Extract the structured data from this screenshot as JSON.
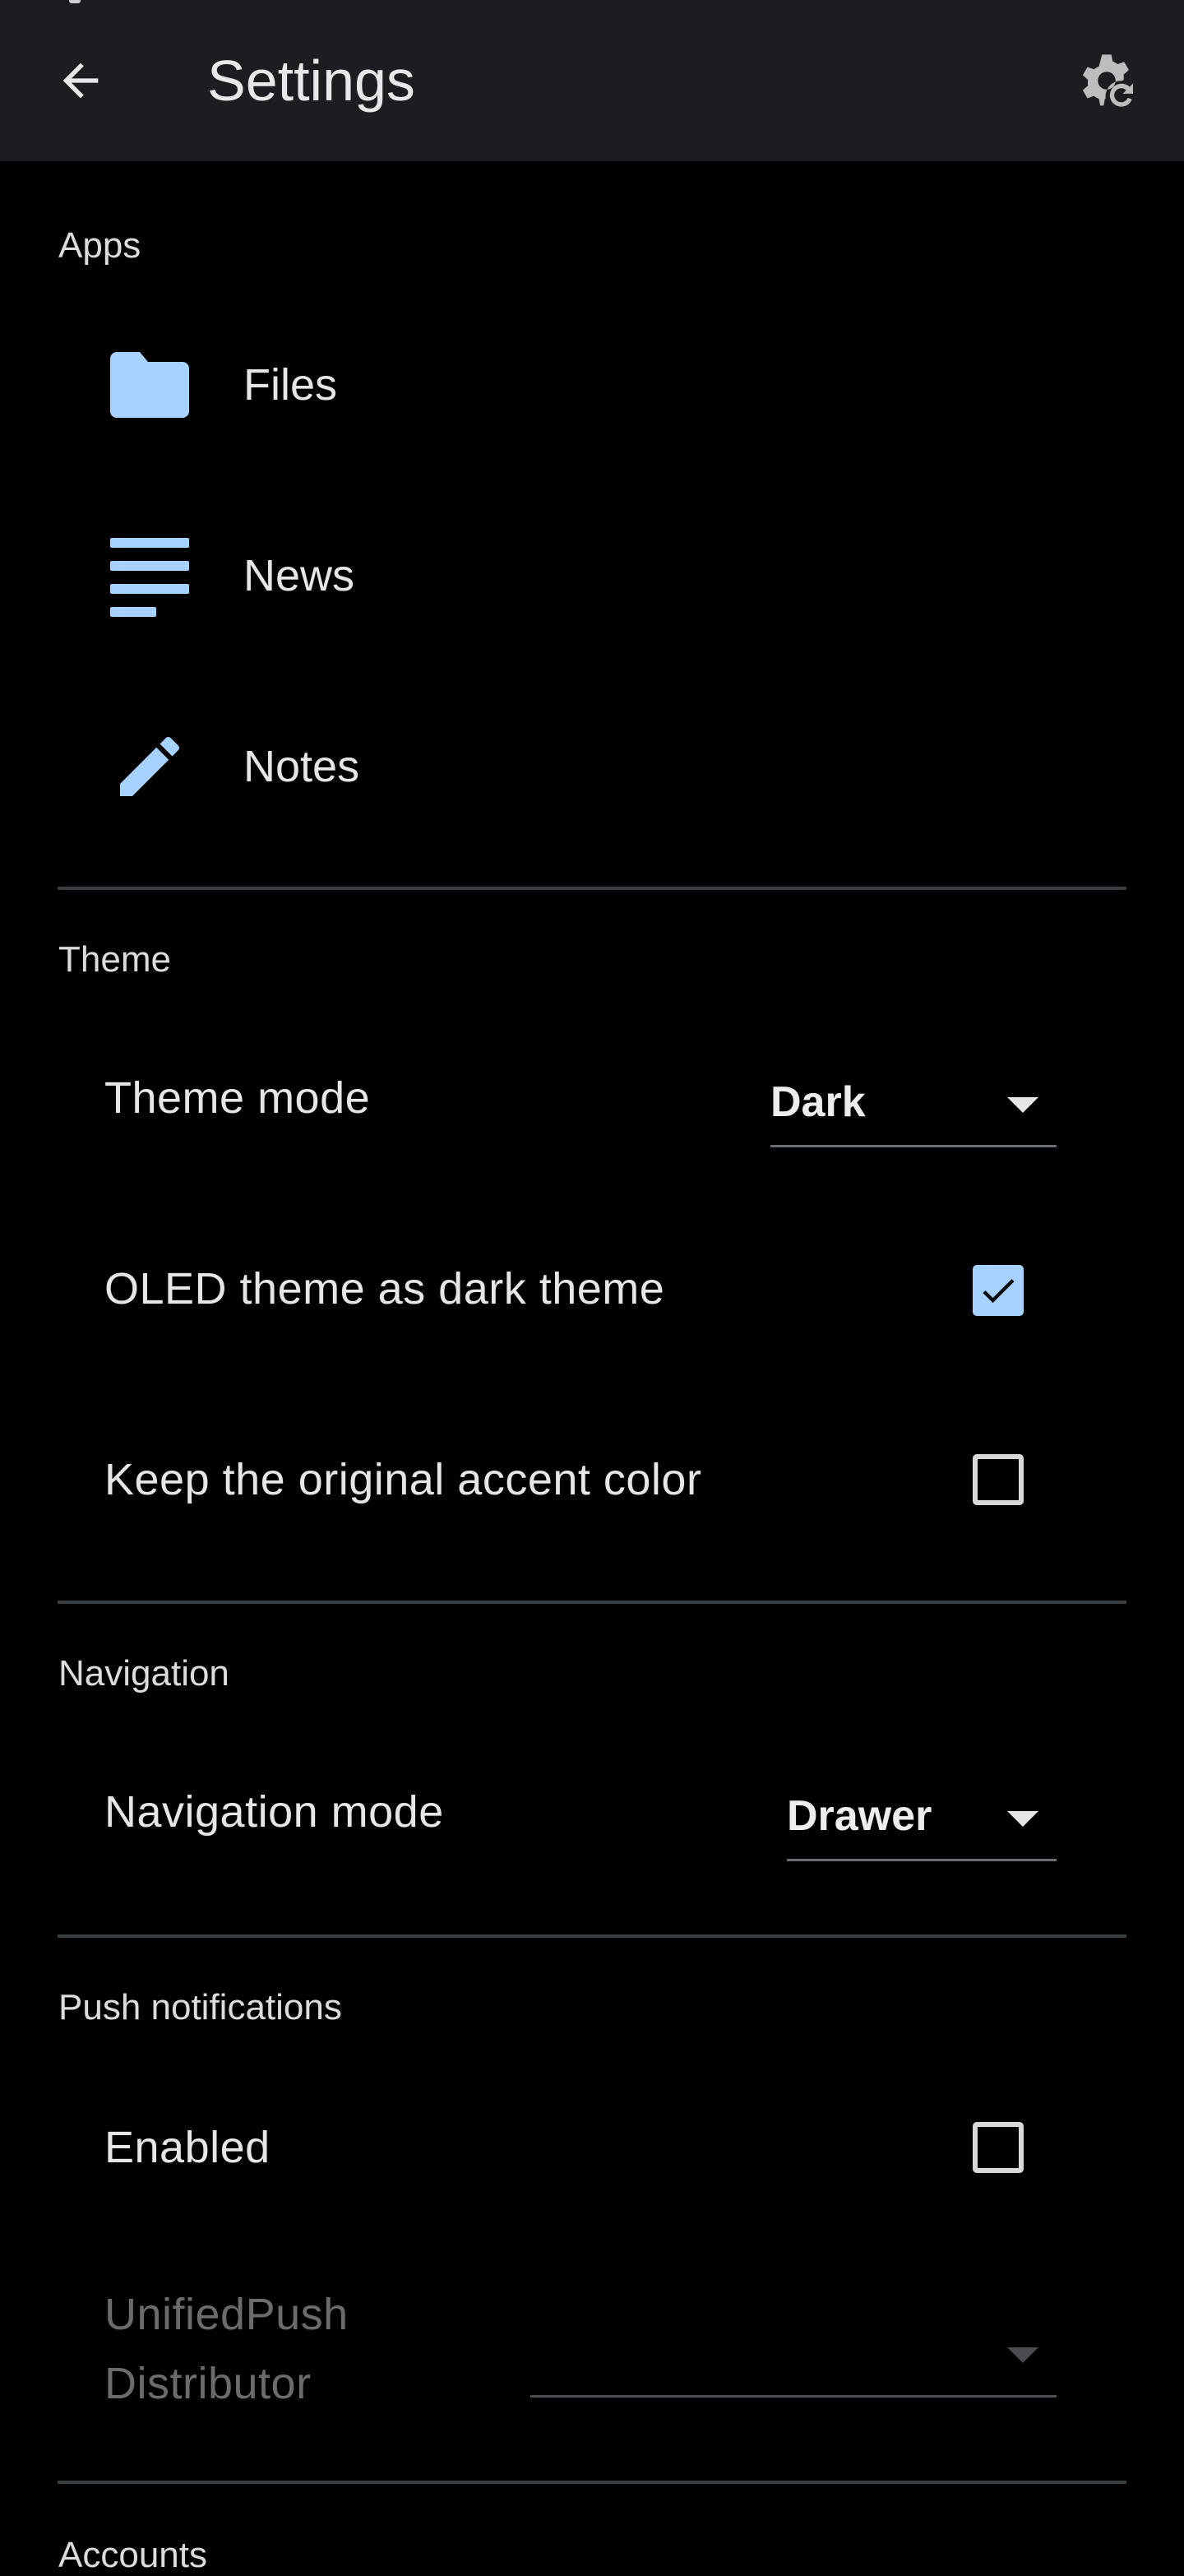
{
  "app_bar": {
    "title": "Settings",
    "back_icon": "arrow-left-icon",
    "action_icon": "gear-refresh-icon"
  },
  "colors": {
    "background": "#000000",
    "app_bar": "#1c1d20",
    "accent": "#a7d1ff",
    "divider": "#3a3d42"
  },
  "apps": {
    "header": "Apps",
    "items": [
      {
        "label": "Files",
        "icon": "folder-icon"
      },
      {
        "label": "News",
        "icon": "news-lines-icon"
      },
      {
        "label": "Notes",
        "icon": "pencil-icon"
      }
    ]
  },
  "theme": {
    "header": "Theme",
    "theme_mode": {
      "label": "Theme mode",
      "value": "Dark"
    },
    "oled": {
      "label": "OLED theme as dark theme",
      "checked": true
    },
    "accent": {
      "label": "Keep the original accent color",
      "checked": false
    }
  },
  "navigation": {
    "header": "Navigation",
    "mode": {
      "label": "Navigation mode",
      "value": "Drawer"
    }
  },
  "push": {
    "header": "Push notifications",
    "enabled": {
      "label": "Enabled",
      "checked": false
    },
    "distributor": {
      "label": "UnifiedPush Distributor",
      "value": "",
      "disabled": true
    }
  },
  "accounts": {
    "header": "Accounts"
  }
}
